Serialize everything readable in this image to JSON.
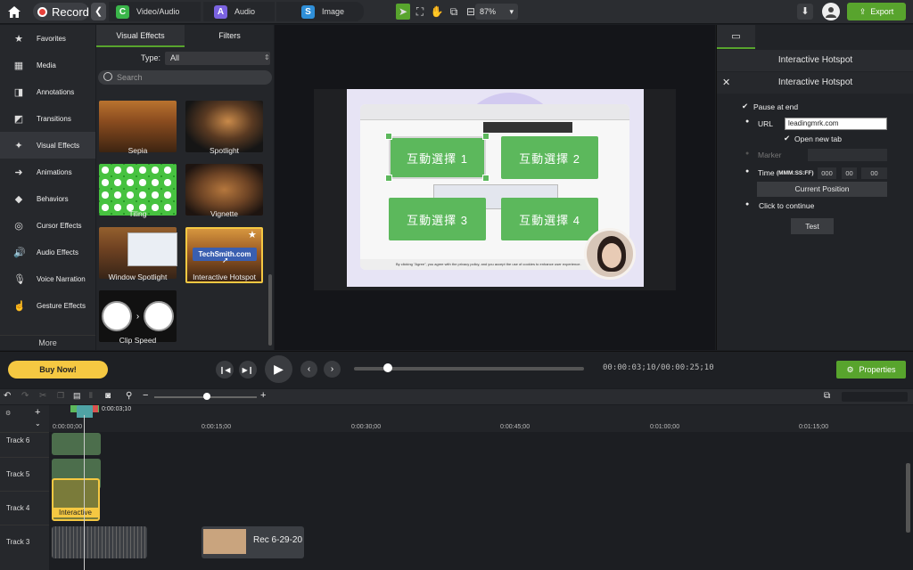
{
  "topbar": {
    "record_label": "Record",
    "library_tabs": [
      {
        "label": "Video/Audio",
        "icon": "C",
        "color": "#3ab54a"
      },
      {
        "label": "Audio",
        "icon": "A",
        "color": "#7b63e0"
      },
      {
        "label": "Image",
        "icon": "S",
        "color": "#2f8fd8"
      }
    ],
    "zoom": "87%",
    "export_label": "Export"
  },
  "tools": [
    {
      "label": "Favorites",
      "icon": "★"
    },
    {
      "label": "Media",
      "icon": "▦"
    },
    {
      "label": "Annotations",
      "icon": "◨"
    },
    {
      "label": "Transitions",
      "icon": "◩"
    },
    {
      "label": "Visual Effects",
      "icon": "✦"
    },
    {
      "label": "Animations",
      "icon": "➜"
    },
    {
      "label": "Behaviors",
      "icon": "◆"
    },
    {
      "label": "Cursor Effects",
      "icon": "◎"
    },
    {
      "label": "Audio Effects",
      "icon": "🔊"
    },
    {
      "label": "Voice Narration",
      "icon": "🎙"
    },
    {
      "label": "Gesture Effects",
      "icon": "☝"
    }
  ],
  "tools_more": "More",
  "effects": {
    "tabs": [
      "Visual Effects",
      "Filters"
    ],
    "type_label": "Type:",
    "type_value": "All",
    "search_placeholder": "Search",
    "items": [
      "Sepia",
      "Spotlight",
      "Tiling",
      "Vignette",
      "Window Spotlight",
      "Interactive Hotspot",
      "Clip Speed"
    ],
    "hotspot_thumb_text": "TechSmith.com"
  },
  "canvas": {
    "hotspots": [
      "互動選擇 1",
      "互動選擇 2",
      "互動選擇 3",
      "互動選擇 4"
    ],
    "cookie_text": "By clicking \"Agree\", you agree with the privacy policy, and you accept the use of cookies to enhance user experience."
  },
  "properties": {
    "header": "Interactive Hotspot",
    "title": "Interactive Hotspot",
    "pause_at_end": "Pause at end",
    "url_label": "URL",
    "url_value": "leadingmrk.com",
    "open_new_tab": "Open new tab",
    "marker_label": "Marker",
    "time_label": "Time",
    "time_format": "(MMM:SS:FF)",
    "time_values": [
      "000",
      "00",
      "00"
    ],
    "current_position": "Current Position",
    "click_to_continue": "Click to continue",
    "test_label": "Test"
  },
  "transport": {
    "buy_now": "Buy Now!",
    "time_current": "00:00:03;10",
    "time_total": "00:00:25;10",
    "properties_label": "Properties"
  },
  "timeline": {
    "playhead_time": "0:00:03;10",
    "ruler_labels": [
      "0:00:00;00",
      "0:00:15;00",
      "0:00:30;00",
      "0:00:45;00",
      "0:01:00;00",
      "0:01:15;00"
    ],
    "tracks": [
      "Track 6",
      "Track 5",
      "Track 4",
      "Track 3"
    ],
    "clip_interactive": "Interactive",
    "clip_rec": "Rec 6-29-20"
  }
}
